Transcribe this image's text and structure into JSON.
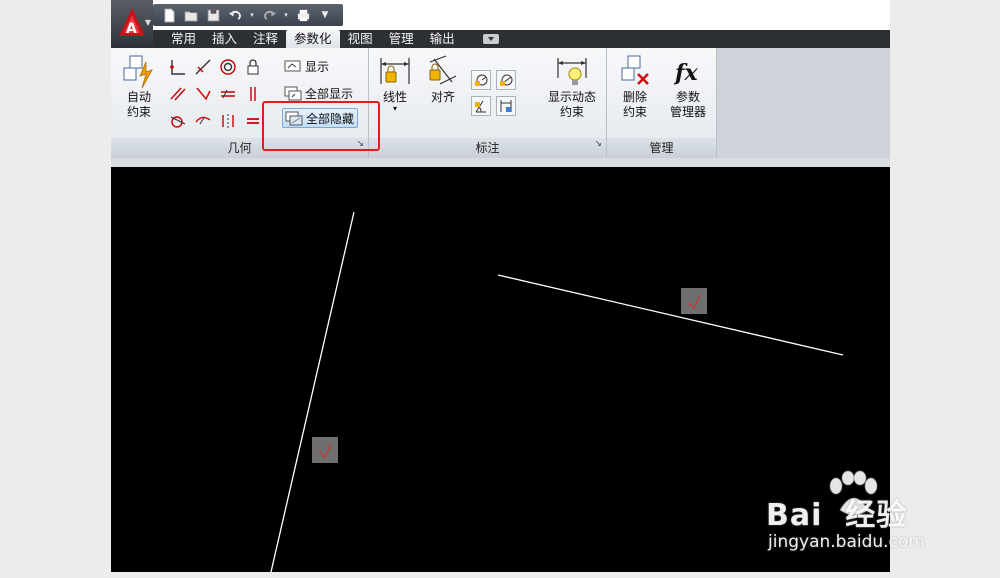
{
  "colors": {
    "highlight": "#e21b1b",
    "canvas": "#000000",
    "ribbon": "#eef0f3",
    "tabbar": "#2c2f34"
  },
  "quick_access": {
    "icons": [
      "new-file-icon",
      "open-folder-icon",
      "save-icon",
      "undo-icon",
      "redo-icon",
      "print-icon"
    ]
  },
  "tabs": [
    {
      "label": "常用"
    },
    {
      "label": "插入"
    },
    {
      "label": "注释"
    },
    {
      "label": "参数化",
      "active": true
    },
    {
      "label": "视图"
    },
    {
      "label": "管理"
    },
    {
      "label": "输出"
    }
  ],
  "ribbon": {
    "geometry": {
      "title": "几何",
      "auto_constrain_label": "自动\n约束",
      "show_label": "显示",
      "show_all_label": "全部显示",
      "hide_all_label": "全部隐藏"
    },
    "dimension": {
      "title": "标注",
      "linear_label": "线性",
      "aligned_label": "对齐",
      "show_dynamic_label": "显示动态\n约束"
    },
    "manage": {
      "title": "管理",
      "delete_constraints_label": "删除\n约束",
      "parameters_manager_label": "参数\n管理器"
    }
  },
  "watermark": {
    "brand": "Bai  经验",
    "url": "jingyan.baidu.com"
  }
}
